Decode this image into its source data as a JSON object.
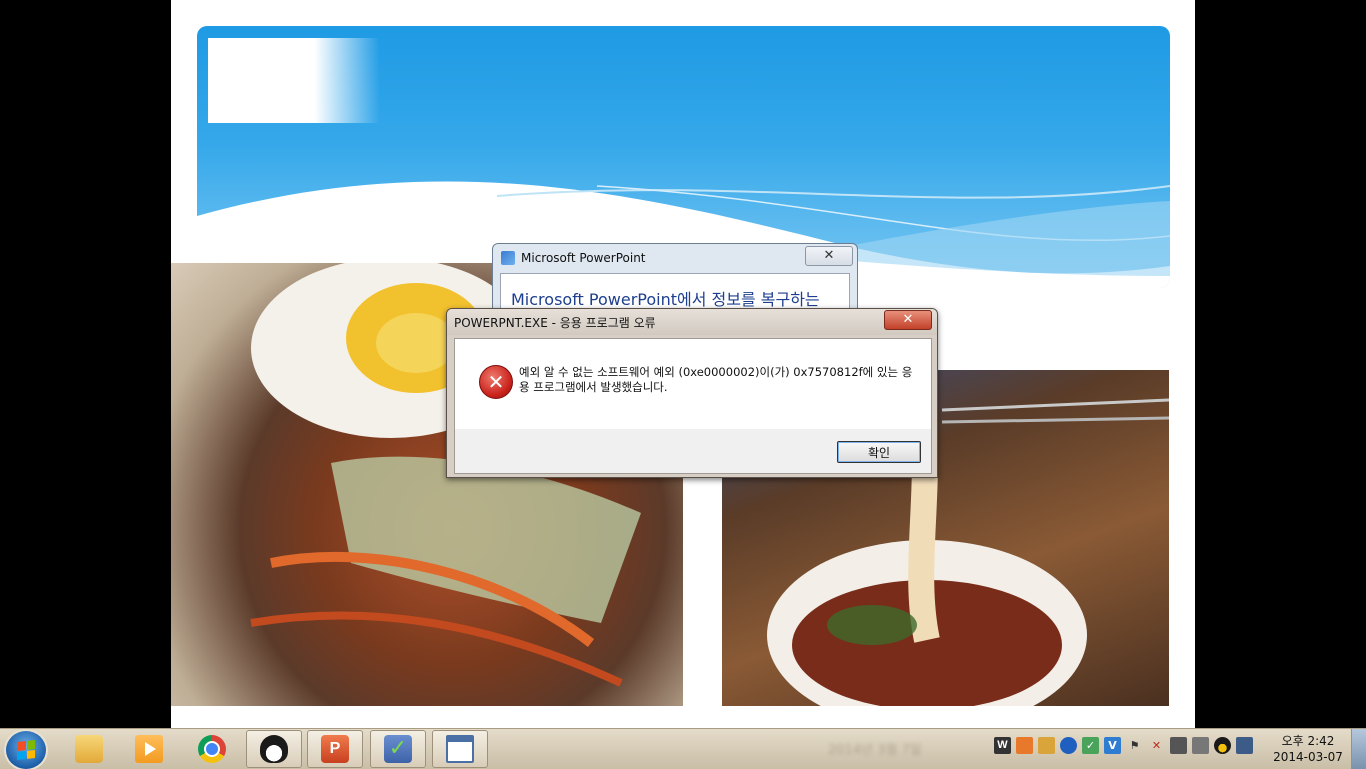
{
  "pp_dialog": {
    "title": "Microsoft PowerPoint",
    "close_glyph": "✕",
    "heading": "Microsoft PowerPoint에서 정보를 복구하는"
  },
  "error_dialog": {
    "title": "POWERPNT.EXE - 응용 프로그램 오류",
    "close_glyph": "✕",
    "icon_glyph": "✕",
    "message": "예외 알 수 없는 소프트웨어 예외 (0xe0000002)이(가) 0x7570812f에 있는 응용 프로그램에서 발생했습니다.",
    "ok_label": "확인"
  },
  "taskbar": {
    "start_icon": "windows-start-orb",
    "buttons": [
      {
        "name": "explorer",
        "icon": "folder-icon",
        "color": "#e9b649",
        "active": true
      },
      {
        "name": "media-player",
        "icon": "media-player-icon",
        "color": "#f29b20",
        "active": false
      },
      {
        "name": "chrome",
        "icon": "chrome-icon",
        "color": "#d9453a",
        "active": false
      },
      {
        "name": "messenger",
        "icon": "penguin-icon",
        "color": "#222222",
        "active": true
      },
      {
        "name": "powerpoint",
        "icon": "powerpoint-icon",
        "color": "#d24726",
        "active": true
      },
      {
        "name": "checklist",
        "icon": "checkmark-icon",
        "color": "#3c8c3c",
        "active": true
      },
      {
        "name": "window-app",
        "icon": "window-icon",
        "color": "#4a6fa5",
        "active": true
      }
    ],
    "blurred_text": "2014년 3월 7일",
    "clock_time": "오후 2:42",
    "clock_date": "2014-03-07"
  }
}
